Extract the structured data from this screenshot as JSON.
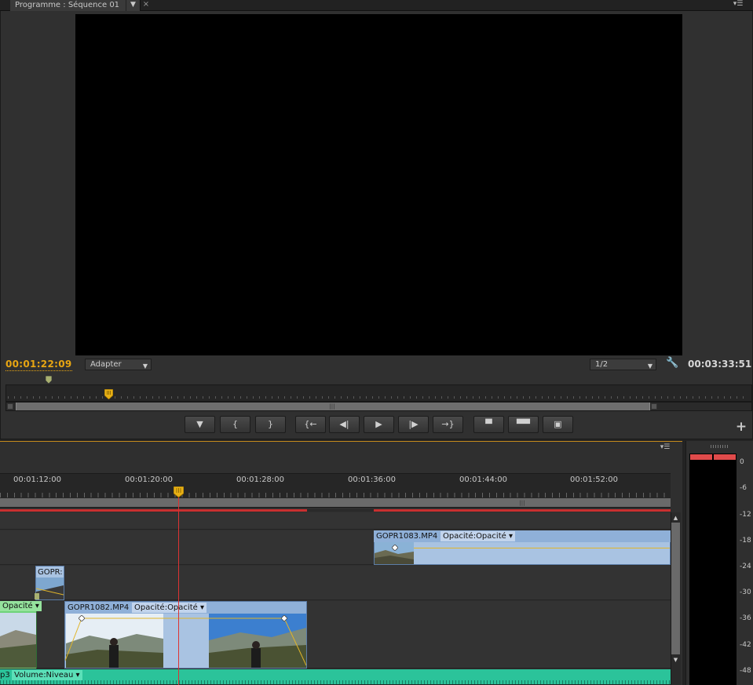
{
  "program_monitor": {
    "tab_title": "Programme : Séquence 01",
    "tab_menu_icon": "chevron-down-icon",
    "close_icon": "close-icon",
    "current_timecode": "00:01:22:09",
    "duration_timecode": "00:03:33:51",
    "zoom_select": "Adapter",
    "resolution_select": "1/2"
  },
  "transport": {
    "buttons": [
      {
        "name": "add-marker-button",
        "glyph": "▼"
      },
      {
        "name": "mark-in-button",
        "glyph": "{"
      },
      {
        "name": "mark-out-button",
        "glyph": "}"
      },
      {
        "name": "go-to-in-button",
        "glyph": "{←"
      },
      {
        "name": "step-back-button",
        "glyph": "◀|"
      },
      {
        "name": "play-button",
        "glyph": "▶"
      },
      {
        "name": "step-forward-button",
        "glyph": "|▶"
      },
      {
        "name": "go-to-out-button",
        "glyph": "→}"
      },
      {
        "name": "lift-button",
        "glyph": "▀"
      },
      {
        "name": "extract-button",
        "glyph": "▀▀"
      },
      {
        "name": "export-frame-button",
        "glyph": "▣"
      }
    ],
    "add_glyph": "+"
  },
  "timeline": {
    "ruler_labels": [
      "00:01:12:00",
      "00:01:20:00",
      "00:01:28:00",
      "00:01:36:00",
      "00:01:44:00",
      "00:01:52:00"
    ],
    "clips": {
      "gopr1083": {
        "name": "GOPR1083.MP4",
        "effect": "Opacité:Opacité"
      },
      "small": {
        "name": "GOPR:"
      },
      "green": {
        "effect": "Opacité"
      },
      "gopr1082": {
        "name": "GOPR1082.MP4",
        "effect": "Opacité:Opacité"
      },
      "audio": {
        "name": "p3",
        "effect": "Volume:Niveau"
      }
    }
  },
  "meters": {
    "db_labels": [
      "0",
      "-6",
      "-12",
      "-18",
      "-24",
      "-30",
      "-36",
      "-42",
      "-48"
    ]
  },
  "colors": {
    "accent_timecode": "#e8a612",
    "clip_blue": "#a9c3e2",
    "clip_green": "#6fd37a",
    "audio_teal": "#2bc39a",
    "playhead_red": "#dd3333"
  }
}
